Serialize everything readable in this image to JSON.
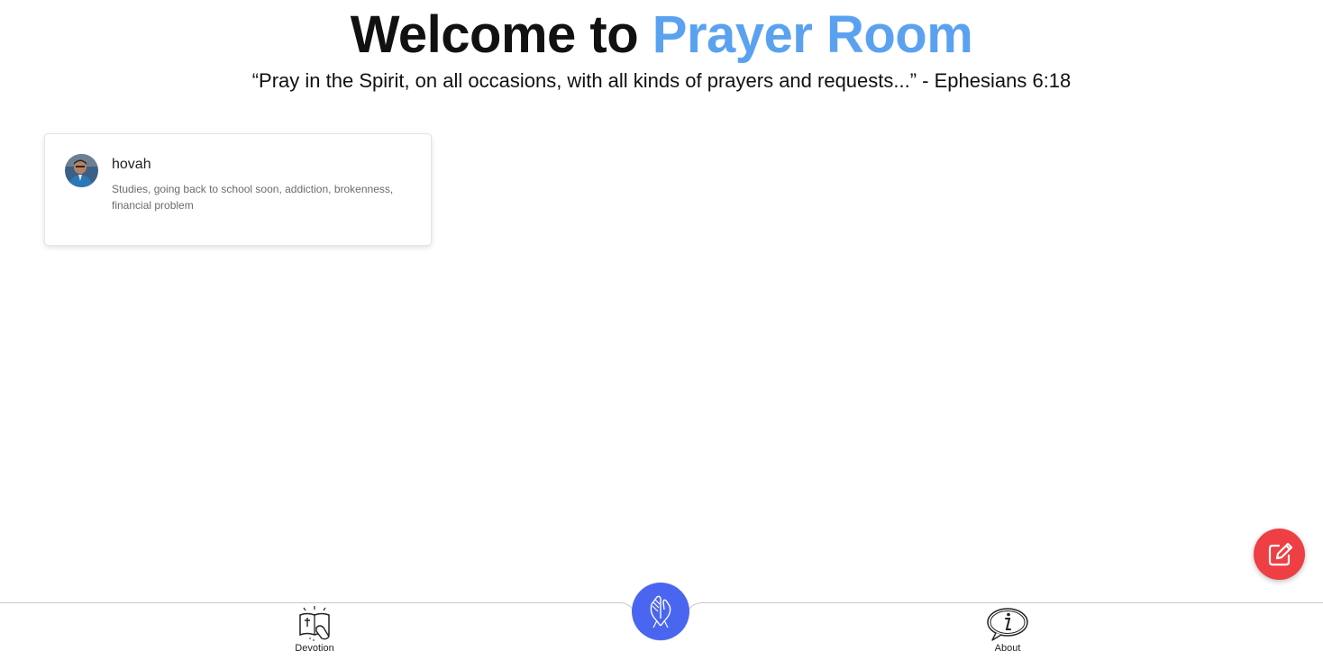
{
  "header": {
    "title_prefix": "Welcome to",
    "title_accent": "Prayer Room",
    "verse": "“Pray in the Spirit, on all occasions, with all kinds of prayers and requests...” - Ephesians 6:18"
  },
  "prayers": [
    {
      "name": "hovah",
      "request": "Studies, going back to school soon, addiction, brokenness, financial problem",
      "avatar_icon": "user-photo-avatar"
    }
  ],
  "fab": {
    "icon": "edit-icon",
    "color": "#ee3f44"
  },
  "bottom_nav": {
    "left": {
      "label": "Devotion",
      "icon": "bible-book-icon"
    },
    "center": {
      "icon": "praying-hands-icon",
      "color": "#4a66f0"
    },
    "right": {
      "label": "About",
      "icon": "info-speech-bubble-icon"
    }
  },
  "colors": {
    "accent": "#5aa2f0",
    "text": "#111111",
    "muted": "#6b6b6b"
  }
}
